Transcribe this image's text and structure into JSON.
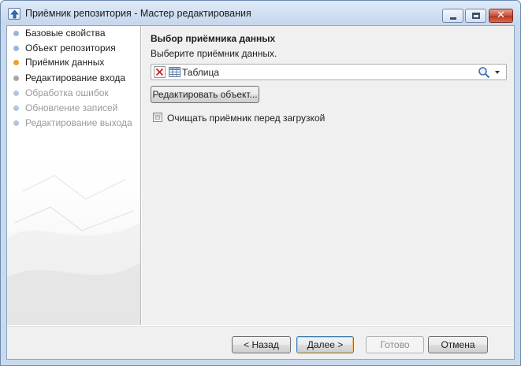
{
  "window": {
    "title": "Приёмник репозитория - Мастер редактирования",
    "icon": "repository-upload-icon",
    "controls": [
      "minimize-icon",
      "maximize-icon",
      "close-icon"
    ],
    "close_glyph": "✕"
  },
  "nav": {
    "items": [
      {
        "label": "Базовые свойства",
        "state": "done"
      },
      {
        "label": "Объект репозитория",
        "state": "done"
      },
      {
        "label": "Приёмник данных",
        "state": "current"
      },
      {
        "label": "Редактирование входа",
        "state": "pending"
      },
      {
        "label": "Обработка ошибок",
        "state": "disabled"
      },
      {
        "label": "Обновление записей",
        "state": "disabled"
      },
      {
        "label": "Редактирование выхода",
        "state": "disabled"
      }
    ]
  },
  "main": {
    "section_title": "Выбор приёмника данных",
    "section_hint": "Выберите приёмник данных.",
    "picker": {
      "value": "Таблица",
      "icons": [
        "clear-icon",
        "table-icon",
        "search-icon",
        "chevron-down-icon"
      ]
    },
    "edit_button": "Редактировать объект...",
    "clear_checkbox": {
      "label": "Очищать приёмник перед загрузкой",
      "checked": false
    }
  },
  "footer": {
    "back": "< Назад",
    "next": "Далее >",
    "done": "Готово",
    "cancel": "Отмена"
  },
  "colors": {
    "accent_current": "#f0a030",
    "done_dot": "#9bb5d6",
    "pending_dot": "#a7a7a7",
    "disabled_text": "#9a9a9a"
  }
}
